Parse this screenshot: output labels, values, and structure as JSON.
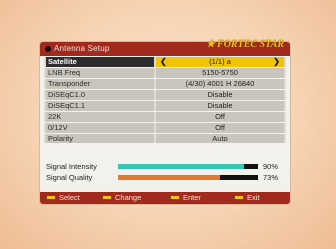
{
  "header": {
    "title": "Antenna Setup",
    "brand": "FORTEC STAR"
  },
  "rows": [
    {
      "label": "Satellite",
      "value": "(1/1) a",
      "selected": true
    },
    {
      "label": "LNB Freq",
      "value": "5150-5750"
    },
    {
      "label": "Transponder",
      "value": "(4/30) 4001 H 26840"
    },
    {
      "label": "DiSEqC1.0",
      "value": "Disable"
    },
    {
      "label": "DiSEqC1.1",
      "value": "Disable"
    },
    {
      "label": "22K",
      "value": "Off"
    },
    {
      "label": "0/12V",
      "value": "Off"
    },
    {
      "label": "Polarity",
      "value": "Auto"
    }
  ],
  "signals": {
    "intensity": {
      "label": "Signal Intensity",
      "percent": 90,
      "percent_text": "90%",
      "color": "#35c7b2"
    },
    "quality": {
      "label": "Signal Quality",
      "percent": 73,
      "percent_text": "73%",
      "color": "#e07a2e"
    }
  },
  "footer": {
    "select": "Select",
    "change": "Change",
    "enter": "Enter",
    "exit": "Exit"
  },
  "colors": {
    "header": "#a22a1d",
    "selected_value": "#f1c400",
    "brand": "#f2c21a"
  }
}
